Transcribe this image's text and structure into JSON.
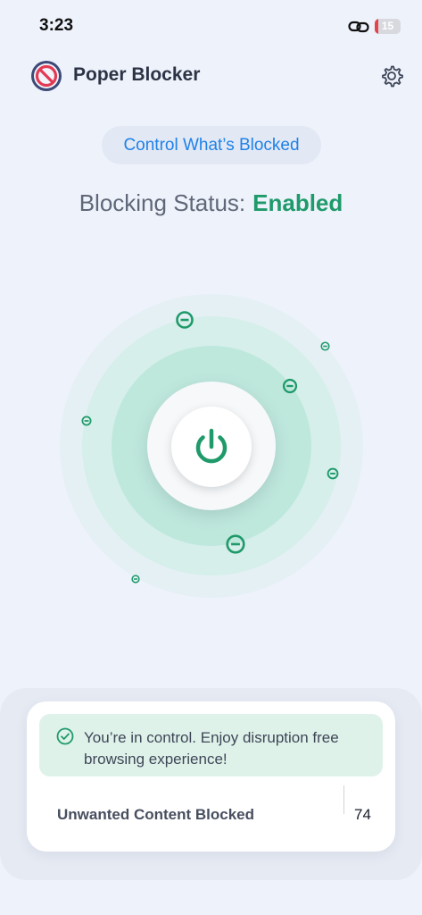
{
  "status_bar": {
    "time": "3:23",
    "battery_level": "15",
    "battery_color": "#e5434a",
    "link_icon": "link-icon"
  },
  "header": {
    "title": "Poper Blocker",
    "logo_icon": "block-sign-icon",
    "settings_icon": "gear-icon"
  },
  "control_button": {
    "label": "Control What’s Blocked"
  },
  "blocking_status": {
    "label": "Blocking Status:",
    "value": "Enabled",
    "value_color": "#1f9a6a"
  },
  "power_button": {
    "icon": "power-icon",
    "accent": "#1f9a6a"
  },
  "card": {
    "notice_icon": "check-circle-icon",
    "notice_line1": "You’re in control. Enjoy disruption free",
    "notice_line2": "browsing experience!",
    "stat_label": "Unwanted Content Blocked",
    "stat_value": "74"
  }
}
